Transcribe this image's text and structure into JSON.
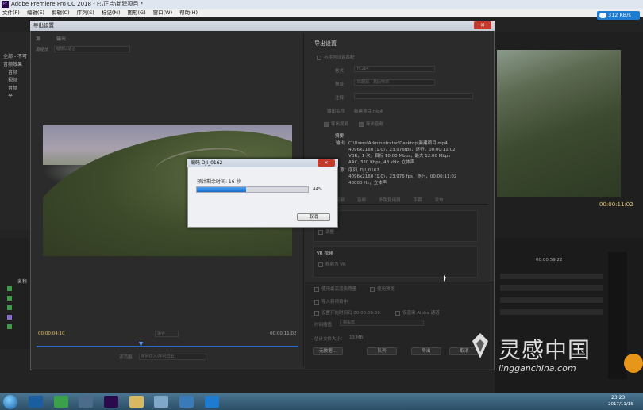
{
  "app": {
    "title": "Adobe Premiere Pro CC 2018 - F:\\正片\\新建项目 *",
    "icon_text": "Pr",
    "menu": [
      "文件(F)",
      "编辑(E)",
      "剪辑(C)",
      "序列(S)",
      "标记(M)",
      "图形(G)",
      "窗口(W)",
      "帮助(H)"
    ],
    "net_speed": "312 KB/s"
  },
  "project_panel": {
    "items": [
      "全部 - 不可",
      "音频效果",
      "音频",
      "视频",
      "音频",
      "平"
    ],
    "name_col": "名称",
    "swatch_colors": [
      "#3e9b46",
      "#3e9b46",
      "#3e9b46",
      "#8c6ad0",
      "#3e9b46"
    ]
  },
  "program_monitor": {
    "timecode": "00:00:11:02",
    "timeline_time": "00:00:59:22"
  },
  "export_dialog": {
    "title": "导出设置",
    "close": "✕",
    "source_tabs": [
      "源",
      "输出"
    ],
    "source_scale_label": "源缩放",
    "source_scale_value": "缩放以适合",
    "time_left": "00:00:04:10",
    "time_right": "00:00:11:02",
    "fit_value": "适合",
    "range_label": "源范围",
    "range_value": "序列切入/序列切出",
    "settings": {
      "title": "导出设置",
      "match_seq": "与序列设置匹配",
      "format_label": "格式",
      "format_value": "H.264",
      "preset_label": "预设",
      "preset_value": "匹配源 - 高比特率",
      "comment_label": "注释",
      "output_label": "输出名称",
      "output_value": "新建项目.mp4",
      "export_video": "导出视频",
      "export_audio": "导出音频",
      "summary_label": "摘要",
      "output_head": "输出",
      "output_line1": "C:\\Users\\Administrator\\Desktop\\新建项目.mp4",
      "output_line2": "4096x2160 (1.0)，23.976fps，逐行，00:00:11:02",
      "output_line3": "VBR，1 次，目标 10.00 Mbps，最大 12.00 Mbps",
      "output_line4": "AAC, 320 Kbps, 48 kHz, 立体声",
      "source_head": "源：",
      "source_line1": "序列, DJI_0162",
      "source_line2": "4096x2160 (1.0)，23.976 fps，逐行，00:00:11:02",
      "source_line3": "48000 Hz，立体声"
    },
    "tabs": [
      "效果",
      "视频",
      "音频",
      "多路复用器",
      "字幕",
      "发布"
    ],
    "effects_head": "频",
    "effects_item": "调整",
    "vr_head": "VR 视频",
    "vr_item": "视频为 VR",
    "bottom": {
      "max_quality": "使用最高渲染质量",
      "use_preview": "使用预览",
      "import_project": "导入到项目中",
      "start_timecode": "设置开始时间码",
      "start_tc_value": "00:00:00:00",
      "alpha": "仅渲染 Alpha 通道",
      "interp_label": "时间插值",
      "interp_value": "帧采样",
      "filesize_label": "估计文件大小：",
      "filesize_value": "13 MB",
      "btn_metadata": "元数据...",
      "btn_queue": "队列",
      "btn_export": "导出",
      "btn_cancel": "取消"
    }
  },
  "encode_dialog": {
    "title": "编码 DJI_0162",
    "close": "✕",
    "remaining": "预计剩余时间: 16 秒",
    "progress": 0.44,
    "percent_label": "44%",
    "cancel": "取消"
  },
  "taskbar": {
    "time": "23:23",
    "date": "2017/11/16"
  },
  "watermark": {
    "cn": "灵感中国",
    "en": "lingganchina.com"
  }
}
